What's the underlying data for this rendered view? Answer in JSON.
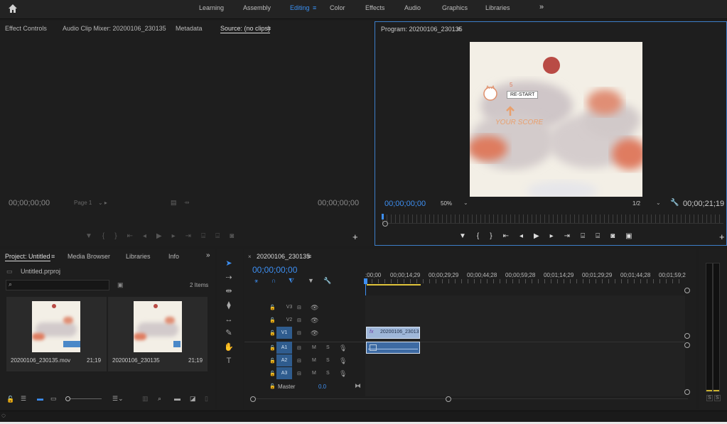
{
  "workspace_tabs": [
    "Learning",
    "Assembly",
    "Editing",
    "Color",
    "Effects",
    "Audio",
    "Graphics",
    "Libraries"
  ],
  "active_workspace": "Editing",
  "source_panel": {
    "tabs": [
      "Effect Controls",
      "Audio Clip Mixer: 20200106_230135",
      "Metadata",
      "Source: (no clips)"
    ],
    "timecode_left": "00;00;00;00",
    "page": "Page 1",
    "timecode_right": "00;00;00;00"
  },
  "program_panel": {
    "title": "Program: 20200106_230135",
    "timecode": "00;00;00;00",
    "zoom": "50%",
    "resolution": "1/2",
    "duration": "00;00;21;19",
    "game": {
      "score": "5",
      "restart_label": "RE-START",
      "your_score": "YOUR SCORE"
    }
  },
  "project_panel": {
    "tabs": [
      "Project: Untitled",
      "Media Browser",
      "Libraries",
      "Info"
    ],
    "project_file": "Untitled.prproj",
    "items_count": "2 Items",
    "items": [
      {
        "name": "20200106_230135.mov",
        "duration": "21;19"
      },
      {
        "name": "20200106_230135",
        "duration": "21;19"
      }
    ]
  },
  "timeline": {
    "sequence_name": "20200106_230135",
    "timecode": "00;00;00;00",
    "ruler": [
      ":00;00",
      "00;00;14;29",
      "00;00;29;29",
      "00;00;44;28",
      "00;00;59;28",
      "00;01;14;29",
      "00;01;29;29",
      "00;01;44;28",
      "00;01;59;2"
    ],
    "video_tracks": [
      "V3",
      "V2",
      "V1"
    ],
    "audio_tracks": [
      "A1",
      "A2",
      "A3"
    ],
    "master_label": "Master",
    "master_value": "0.0",
    "clip_label": "20200106_23013",
    "clip_badge": "fx"
  },
  "meter": {
    "solo_labels": [
      "S",
      "S"
    ]
  }
}
